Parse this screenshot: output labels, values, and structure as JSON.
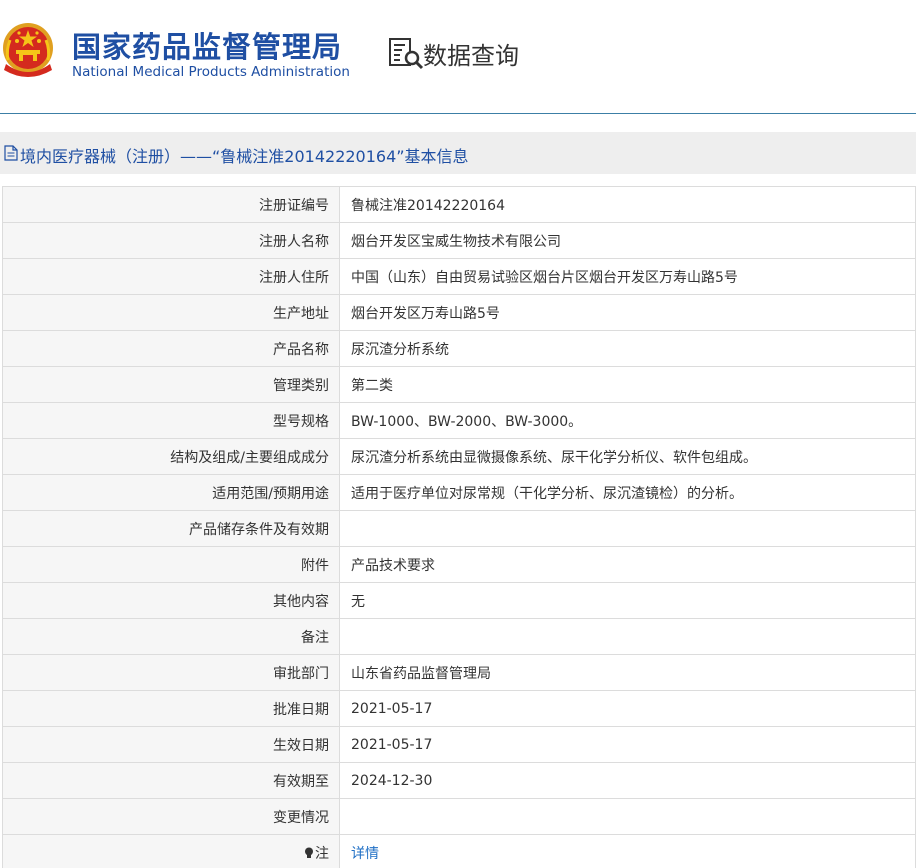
{
  "header": {
    "brand_cn": "国家药品监督管理局",
    "brand_en": "National Medical Products Administration",
    "search_label": "数据查询",
    "brand_color": "#1f4fa3"
  },
  "title_bar": {
    "title": "境内医疗器械（注册）——“鲁械注准20142220164”基本信息"
  },
  "rows": [
    {
      "label": "注册证编号",
      "value": "鲁械注准20142220164"
    },
    {
      "label": "注册人名称",
      "value": "烟台开发区宝威生物技术有限公司"
    },
    {
      "label": "注册人住所",
      "value": "中国（山东）自由贸易试验区烟台片区烟台开发区万寿山路5号"
    },
    {
      "label": "生产地址",
      "value": "烟台开发区万寿山路5号"
    },
    {
      "label": "产品名称",
      "value": "尿沉渣分析系统"
    },
    {
      "label": "管理类别",
      "value": "第二类"
    },
    {
      "label": "型号规格",
      "value": "BW-1000、BW-2000、BW-3000。"
    },
    {
      "label": "结构及组成/主要组成成分",
      "value": "尿沉渣分析系统由显微摄像系统、尿干化学分析仪、软件包组成。"
    },
    {
      "label": "适用范围/预期用途",
      "value": "适用于医疗单位对尿常规（干化学分析、尿沉渣镜检）的分析。"
    },
    {
      "label": "产品储存条件及有效期",
      "value": ""
    },
    {
      "label": "附件",
      "value": "产品技术要求"
    },
    {
      "label": "其他内容",
      "value": "无"
    },
    {
      "label": "备注",
      "value": ""
    },
    {
      "label": "审批部门",
      "value": "山东省药品监督管理局"
    },
    {
      "label": "批准日期",
      "value": "2021-05-17"
    },
    {
      "label": "生效日期",
      "value": "2021-05-17"
    },
    {
      "label": "有效期至",
      "value": "2024-12-30"
    },
    {
      "label": "变更情况",
      "value": ""
    }
  ],
  "note_row": {
    "icon": "lightbulb-icon",
    "label": "注",
    "link_text": "详情"
  }
}
